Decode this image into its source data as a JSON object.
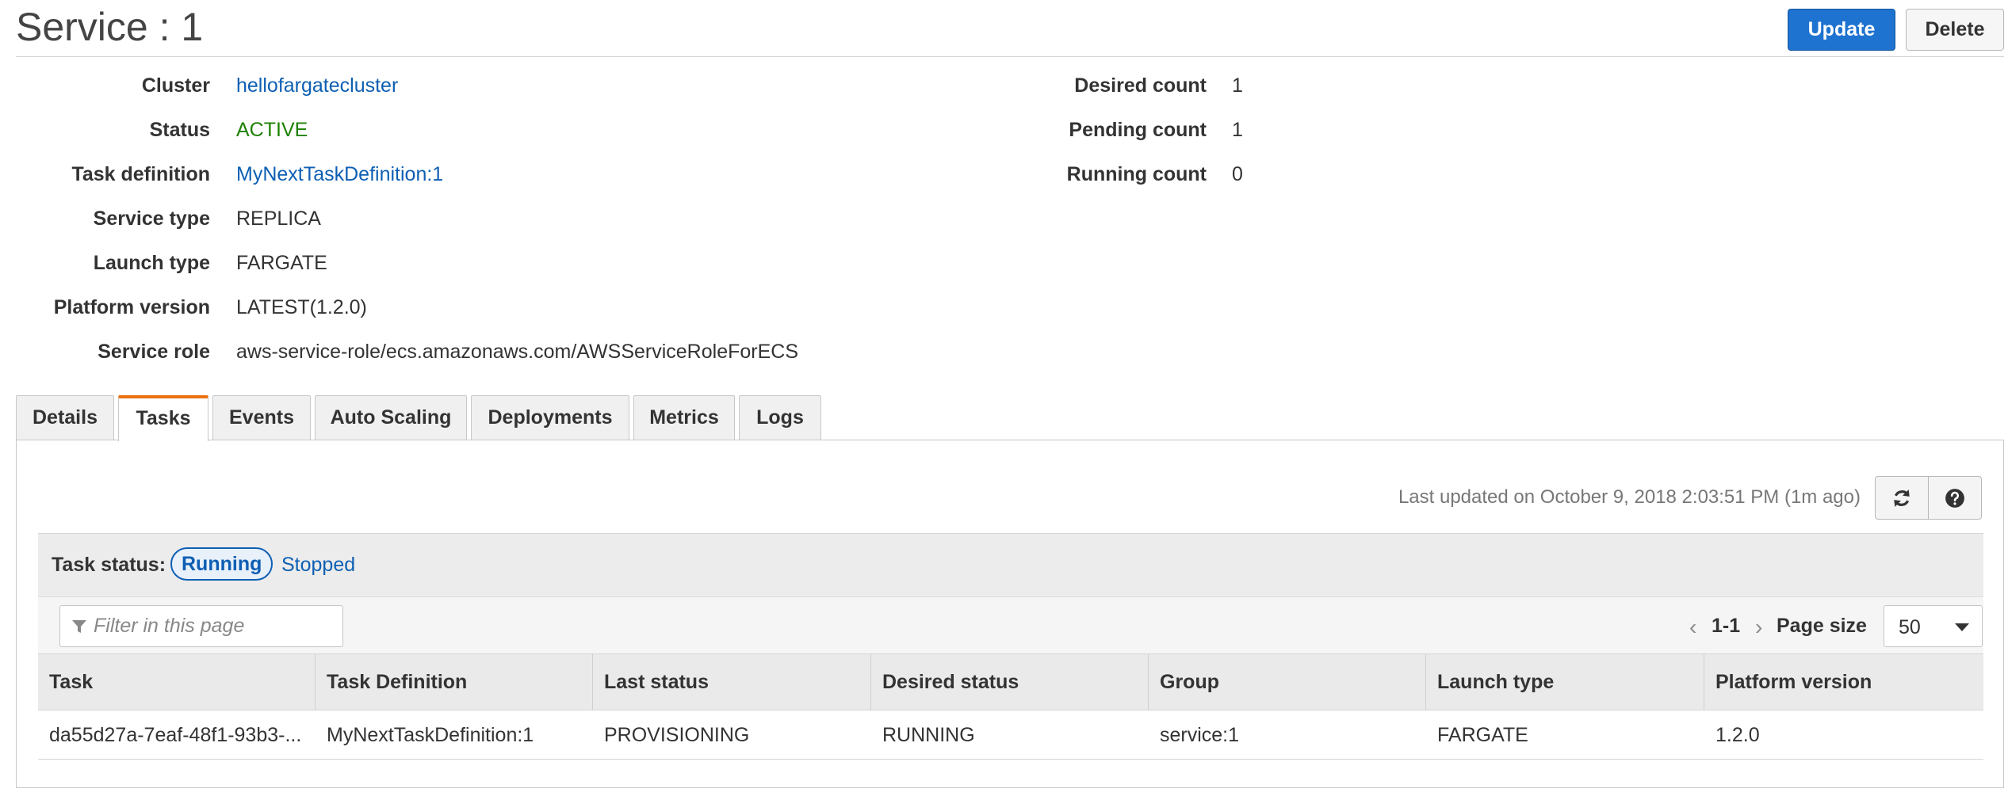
{
  "header": {
    "title": "Service : 1",
    "update_label": "Update",
    "delete_label": "Delete"
  },
  "details": {
    "left": [
      {
        "label": "Cluster",
        "value": "hellofargatecluster"
      },
      {
        "label": "Status",
        "value": "ACTIVE"
      },
      {
        "label": "Task definition",
        "value": "MyNextTaskDefinition:1"
      },
      {
        "label": "Service type",
        "value": "REPLICA"
      },
      {
        "label": "Launch type",
        "value": "FARGATE"
      },
      {
        "label": "Platform version",
        "value": "LATEST(1.2.0)"
      },
      {
        "label": "Service role",
        "value": "aws-service-role/ecs.amazonaws.com/AWSServiceRoleForECS"
      }
    ],
    "right": [
      {
        "label": "Desired count",
        "value": "1"
      },
      {
        "label": "Pending count",
        "value": "1"
      },
      {
        "label": "Running count",
        "value": "0"
      }
    ]
  },
  "tabs": [
    {
      "label": "Details"
    },
    {
      "label": "Tasks"
    },
    {
      "label": "Events"
    },
    {
      "label": "Auto Scaling"
    },
    {
      "label": "Deployments"
    },
    {
      "label": "Metrics"
    },
    {
      "label": "Logs"
    }
  ],
  "tasks_panel": {
    "last_updated": "Last updated on October 9, 2018 2:03:51 PM (1m ago)",
    "status_label": "Task status:",
    "status_running": "Running",
    "status_stopped": "Stopped",
    "filter_placeholder": "Filter in this page",
    "pager_range": "1-1",
    "page_size_label": "Page size",
    "page_size_value": "50",
    "columns": [
      "Task",
      "Task Definition",
      "Last status",
      "Desired status",
      "Group",
      "Launch type",
      "Platform version"
    ],
    "rows": [
      {
        "task": "da55d27a-7eaf-48f1-93b3-...",
        "task_definition": "MyNextTaskDefinition:1",
        "last_status": "PROVISIONING",
        "desired_status": "RUNNING",
        "group": "service:1",
        "launch_type": "FARGATE",
        "platform_version": "1.2.0"
      }
    ]
  }
}
